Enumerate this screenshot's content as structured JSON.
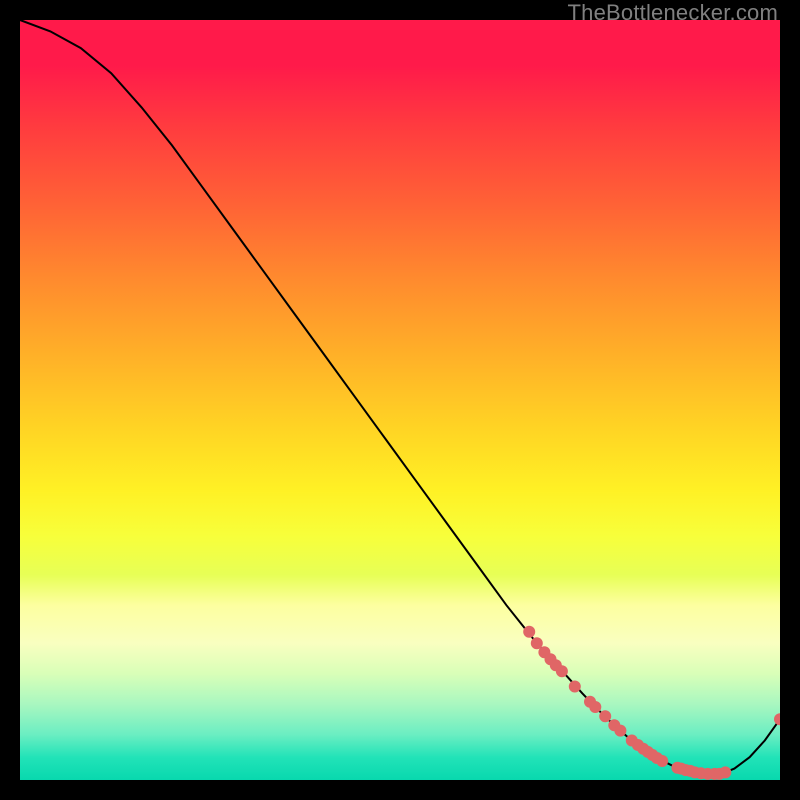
{
  "watermark": "TheBottlenecker.com",
  "colors": {
    "dot": "#e06666",
    "curve": "#000000",
    "background": "#000000"
  },
  "chart_data": {
    "type": "line",
    "title": "",
    "xlabel": "",
    "ylabel": "",
    "xlim": [
      0,
      100
    ],
    "ylim": [
      0,
      100
    ],
    "grid": false,
    "series": [
      {
        "name": "bottleneck-curve",
        "x": [
          0,
          4,
          8,
          12,
          16,
          20,
          24,
          28,
          32,
          36,
          40,
          44,
          48,
          52,
          56,
          60,
          64,
          66,
          68,
          70,
          72,
          74,
          76,
          78,
          80,
          82,
          84,
          86,
          88,
          90,
          92,
          94,
          96,
          98,
          100
        ],
        "y": [
          100,
          98.5,
          96.3,
          93.0,
          88.5,
          83.5,
          78.0,
          72.5,
          67.0,
          61.5,
          56.0,
          50.5,
          45.0,
          39.5,
          34.0,
          28.5,
          23.0,
          20.5,
          18.0,
          15.8,
          13.6,
          11.4,
          9.3,
          7.4,
          5.6,
          4.1,
          2.8,
          1.8,
          1.1,
          0.7,
          0.7,
          1.5,
          3.0,
          5.2,
          8.0
        ]
      }
    ],
    "markers": [
      {
        "name": "pt-a",
        "x": 67.0,
        "y": 19.5
      },
      {
        "name": "pt-b",
        "x": 68.0,
        "y": 18.0
      },
      {
        "name": "pt-c1",
        "x": 69.0,
        "y": 16.8
      },
      {
        "name": "pt-c2",
        "x": 69.8,
        "y": 15.9
      },
      {
        "name": "pt-c3",
        "x": 70.5,
        "y": 15.1
      },
      {
        "name": "pt-c4",
        "x": 71.3,
        "y": 14.3
      },
      {
        "name": "pt-d",
        "x": 73.0,
        "y": 12.3
      },
      {
        "name": "pt-e1",
        "x": 75.0,
        "y": 10.3
      },
      {
        "name": "pt-e2",
        "x": 75.7,
        "y": 9.6
      },
      {
        "name": "pt-f",
        "x": 77.0,
        "y": 8.4
      },
      {
        "name": "pt-g1",
        "x": 78.2,
        "y": 7.2
      },
      {
        "name": "pt-g2",
        "x": 79.0,
        "y": 6.5
      },
      {
        "name": "pt-h1",
        "x": 80.5,
        "y": 5.2
      },
      {
        "name": "pt-h2",
        "x": 81.3,
        "y": 4.6
      },
      {
        "name": "pt-h3",
        "x": 82.0,
        "y": 4.1
      },
      {
        "name": "pt-i1",
        "x": 82.6,
        "y": 3.7
      },
      {
        "name": "pt-i2",
        "x": 83.2,
        "y": 3.3
      },
      {
        "name": "pt-i3",
        "x": 83.8,
        "y": 2.9
      },
      {
        "name": "pt-i4",
        "x": 84.5,
        "y": 2.5
      },
      {
        "name": "pt-j1",
        "x": 86.5,
        "y": 1.6
      },
      {
        "name": "pt-j2",
        "x": 87.0,
        "y": 1.5
      },
      {
        "name": "pt-j3",
        "x": 87.6,
        "y": 1.3
      },
      {
        "name": "pt-j4",
        "x": 88.2,
        "y": 1.2
      },
      {
        "name": "pt-j5",
        "x": 88.8,
        "y": 1.0
      },
      {
        "name": "pt-j6",
        "x": 89.6,
        "y": 0.9
      },
      {
        "name": "pt-j7",
        "x": 90.5,
        "y": 0.8
      },
      {
        "name": "pt-k1",
        "x": 91.4,
        "y": 0.8
      },
      {
        "name": "pt-k2",
        "x": 92.0,
        "y": 0.8
      },
      {
        "name": "pt-k3",
        "x": 92.8,
        "y": 1.0
      },
      {
        "name": "pt-end",
        "x": 100.0,
        "y": 8.0
      }
    ]
  }
}
